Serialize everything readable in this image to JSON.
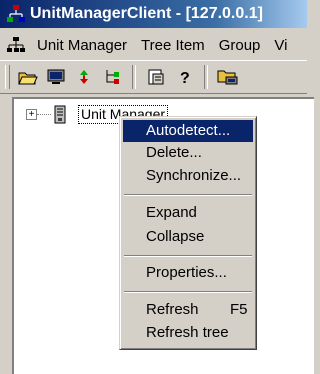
{
  "window": {
    "title": "UnitManagerClient - [127.0.0.1]"
  },
  "menubar": {
    "items": [
      "Unit Manager",
      "Tree Item",
      "Group",
      "Vi"
    ]
  },
  "toolbar": {
    "buttons": [
      "open-folder-icon",
      "monitor-icon",
      "sync-arrows-icon",
      "tree-sync-icon",
      "properties-icon",
      "help-icon",
      "folder-network-icon"
    ]
  },
  "tree": {
    "root_label": "Unit Manager",
    "expander": "+"
  },
  "context_menu": {
    "items": [
      {
        "label": "Autodetect...",
        "selected": true
      },
      {
        "label": "Delete..."
      },
      {
        "label": "Synchronize..."
      },
      {
        "label": "Expand"
      },
      {
        "label": "Collapse"
      },
      {
        "label": "Properties..."
      },
      {
        "label": "Refresh",
        "shortcut": "F5"
      },
      {
        "label": "Refresh tree"
      }
    ]
  },
  "colors": {
    "title_active": "#0a246a",
    "menu_highlight": "#0a246a",
    "face": "#d4d0c8"
  }
}
